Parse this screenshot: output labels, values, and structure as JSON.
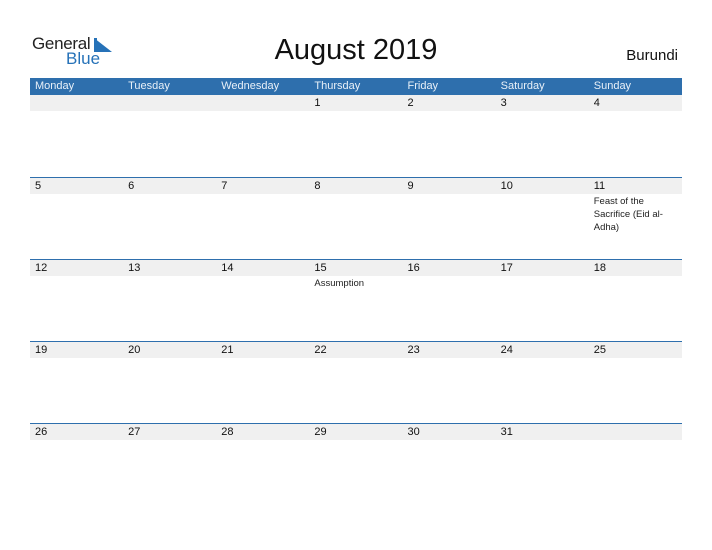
{
  "logo": {
    "line1": "General",
    "line2": "Blue",
    "accent_color": "#2672b8"
  },
  "header": {
    "title": "August 2019",
    "country": "Burundi"
  },
  "calendar": {
    "header_color": "#2e6fad",
    "days": [
      "Monday",
      "Tuesday",
      "Wednesday",
      "Thursday",
      "Friday",
      "Saturday",
      "Sunday"
    ],
    "weeks": [
      {
        "dates": [
          "",
          "",
          "",
          "1",
          "2",
          "3",
          "4"
        ],
        "events": [
          "",
          "",
          "",
          "",
          "",
          "",
          ""
        ]
      },
      {
        "dates": [
          "5",
          "6",
          "7",
          "8",
          "9",
          "10",
          "11"
        ],
        "events": [
          "",
          "",
          "",
          "",
          "",
          "",
          "Feast of the Sacrifice (Eid al-Adha)"
        ]
      },
      {
        "dates": [
          "12",
          "13",
          "14",
          "15",
          "16",
          "17",
          "18"
        ],
        "events": [
          "",
          "",
          "",
          "Assumption",
          "",
          "",
          ""
        ]
      },
      {
        "dates": [
          "19",
          "20",
          "21",
          "22",
          "23",
          "24",
          "25"
        ],
        "events": [
          "",
          "",
          "",
          "",
          "",
          "",
          ""
        ]
      },
      {
        "dates": [
          "26",
          "27",
          "28",
          "29",
          "30",
          "31",
          ""
        ],
        "events": [
          "",
          "",
          "",
          "",
          "",
          "",
          ""
        ]
      }
    ]
  }
}
